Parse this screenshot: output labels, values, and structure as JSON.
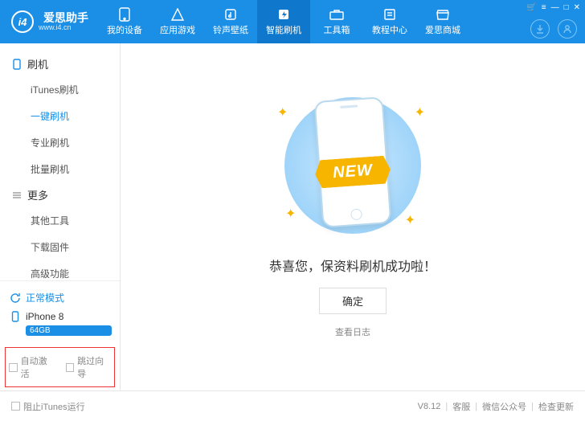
{
  "header": {
    "brand": "爱思助手",
    "brand_sub": "www.i4.cn",
    "logo_text": "i4",
    "nav": [
      {
        "label": "我的设备",
        "icon": "phone"
      },
      {
        "label": "应用游戏",
        "icon": "apps"
      },
      {
        "label": "铃声壁纸",
        "icon": "music"
      },
      {
        "label": "智能刷机",
        "icon": "flash",
        "active": true
      },
      {
        "label": "工具箱",
        "icon": "toolbox"
      },
      {
        "label": "教程中心",
        "icon": "book"
      },
      {
        "label": "爱思商城",
        "icon": "store"
      }
    ],
    "win": {
      "cart": "🛒",
      "menu": "≡",
      "min": "—",
      "max": "□",
      "close": "✕"
    }
  },
  "sidebar": {
    "sections": [
      {
        "title": "刷机",
        "items": [
          "iTunes刷机",
          "一键刷机",
          "专业刷机",
          "批量刷机"
        ],
        "active_index": 1
      },
      {
        "title": "更多",
        "items": [
          "其他工具",
          "下载固件",
          "高级功能"
        ]
      }
    ],
    "mode": "正常模式",
    "device": "iPhone 8",
    "storage": "64GB",
    "opts": {
      "auto_activate": "自动激活",
      "skip_guide": "跳过向导"
    }
  },
  "main": {
    "ribbon": "NEW",
    "message": "恭喜您，保资料刷机成功啦！",
    "ok": "确定",
    "log": "查看日志"
  },
  "footer": {
    "block_itunes": "阻止iTunes运行",
    "version": "V8.12",
    "support": "客服",
    "wechat": "微信公众号",
    "update": "检查更新"
  }
}
